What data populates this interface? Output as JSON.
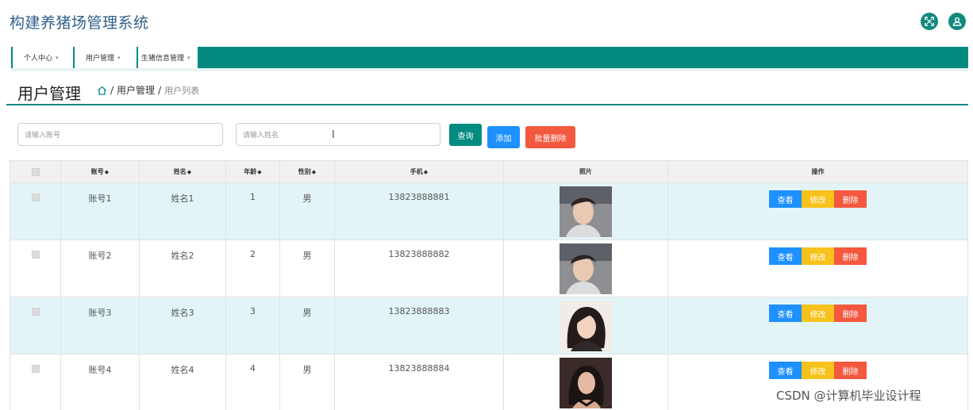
{
  "app": {
    "title": "构建养猪场管理系统",
    "accent": "#038b82"
  },
  "header": {
    "fullscreen_icon": "fullscreen-icon",
    "user_icon": "user-icon"
  },
  "nav": {
    "items": [
      {
        "label": "个人中心"
      },
      {
        "label": "用户管理"
      },
      {
        "label": "生猪信息管理"
      }
    ]
  },
  "page": {
    "title": "用户管理",
    "breadcrumb": {
      "home_icon": "home-icon",
      "sep": "/",
      "section": "用户管理",
      "current": "用户列表"
    }
  },
  "search": {
    "account_placeholder": "请输入账号",
    "name_placeholder": "请输入姓名",
    "search_label": "查询",
    "add_label": "添加",
    "batch_delete_label": "批量删除"
  },
  "table": {
    "columns": [
      "账号",
      "姓名",
      "年龄",
      "性别",
      "手机",
      "照片",
      "操作"
    ],
    "sort_glyph": "◆",
    "action_labels": {
      "view": "查看",
      "edit": "修改",
      "delete": "删除"
    },
    "rows": [
      {
        "account": "账号1",
        "name": "姓名1",
        "age": "1",
        "gender": "男",
        "phone": "13823888881",
        "photo": "male"
      },
      {
        "account": "账号2",
        "name": "姓名2",
        "age": "2",
        "gender": "男",
        "phone": "13823888882",
        "photo": "male"
      },
      {
        "account": "账号3",
        "name": "姓名3",
        "age": "3",
        "gender": "男",
        "phone": "13823888883",
        "photo": "female"
      },
      {
        "account": "账号4",
        "name": "姓名4",
        "age": "4",
        "gender": "男",
        "phone": "13823888884",
        "photo": "female-dark"
      }
    ]
  },
  "watermark": "CSDN @计算机毕业设计程"
}
